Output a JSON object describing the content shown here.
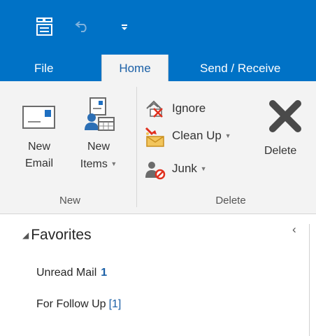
{
  "quick_access": {
    "icons": [
      "send-receive-all-folders-icon",
      "undo-icon",
      "customize-qat-icon"
    ]
  },
  "tabs": [
    {
      "label": "File",
      "active": false
    },
    {
      "label": "Home",
      "active": true
    },
    {
      "label": "Send / Receive",
      "active": false
    }
  ],
  "ribbon": {
    "new_group": {
      "label": "New",
      "new_email": {
        "line1": "New",
        "line2": "Email"
      },
      "new_items": {
        "line1": "New",
        "line2": "Items"
      }
    },
    "delete_group": {
      "label": "Delete",
      "ignore": "Ignore",
      "clean_up": "Clean Up",
      "junk": "Junk",
      "delete": "Delete"
    }
  },
  "folder_pane": {
    "favorites_label": "Favorites",
    "folders": [
      {
        "name": "Unread Mail",
        "count": "1"
      },
      {
        "name": "For Follow Up",
        "count": "[1]"
      }
    ]
  },
  "colors": {
    "accent": "#0072c6",
    "ribbon_bg": "#f3f3f3",
    "count_blue": "#1a5fa6",
    "delete_red": "#e0301e"
  }
}
